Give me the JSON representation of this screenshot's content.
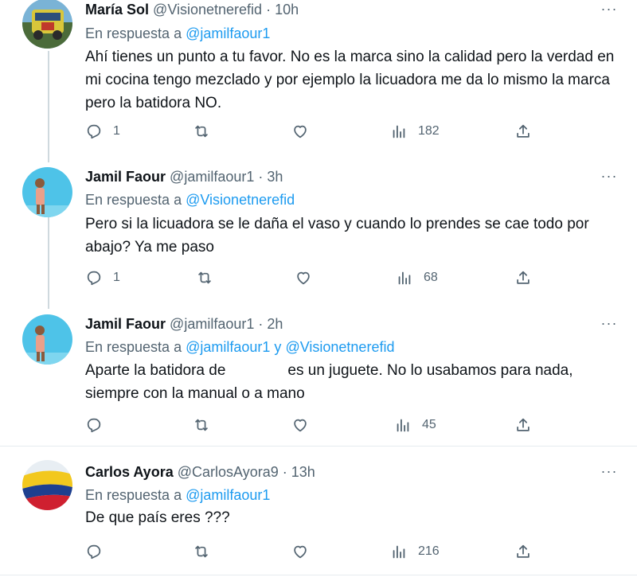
{
  "tweets": [
    {
      "name": "María Sol",
      "handle": "@Visionetnerefid",
      "sep": "·",
      "time": "10h",
      "reply_prefix": "En respuesta a",
      "mention1": "@jamilfaour1",
      "text": "Ahí tienes un punto a tu favor.  No es la marca sino la calidad pero la verdad en mi cocina tengo mezclado y por ejemplo la licuadora me da lo mismo la marca pero la batidora NO.",
      "replies": "1",
      "retweets": "",
      "likes": "",
      "views": "182"
    },
    {
      "name": "Jamil Faour",
      "handle": "@jamilfaour1",
      "sep": "·",
      "time": "3h",
      "reply_prefix": "En respuesta a",
      "mention1": "@Visionetnerefid",
      "text": "Pero si la licuadora se le daña el vaso y cuando lo prendes se cae todo por abajo? Ya me paso",
      "replies": "1",
      "retweets": "",
      "likes": "",
      "views": "68"
    },
    {
      "name": "Jamil Faour",
      "handle": "@jamilfaour1",
      "sep": "·",
      "time": "2h",
      "reply_prefix": "En respuesta a",
      "mention1": "@jamilfaour1",
      "conj": "y",
      "mention2": "@Visionetnerefid",
      "text_a": "Aparte la batidora de",
      "text_b": "es un juguete. No lo usabamos para nada, siempre con la manual o a mano",
      "replies": "",
      "retweets": "",
      "likes": "",
      "views": "45"
    },
    {
      "name": "Carlos Ayora",
      "handle": "@CarlosAyora9",
      "sep": "·",
      "time": "13h",
      "reply_prefix": "En respuesta a",
      "mention1": "@jamilfaour1",
      "text": "De que país eres ???",
      "replies": "",
      "retweets": "",
      "likes": "",
      "views": "216"
    }
  ],
  "more_glyph": "···",
  "icons": [
    "reply-icon",
    "retweet-icon",
    "like-icon",
    "views-icon",
    "share-icon",
    "more-icon"
  ],
  "colors": {
    "link": "#1d9bf0",
    "secondary": "#536471",
    "text": "#0f1419",
    "thread_line": "#cfd9de"
  }
}
